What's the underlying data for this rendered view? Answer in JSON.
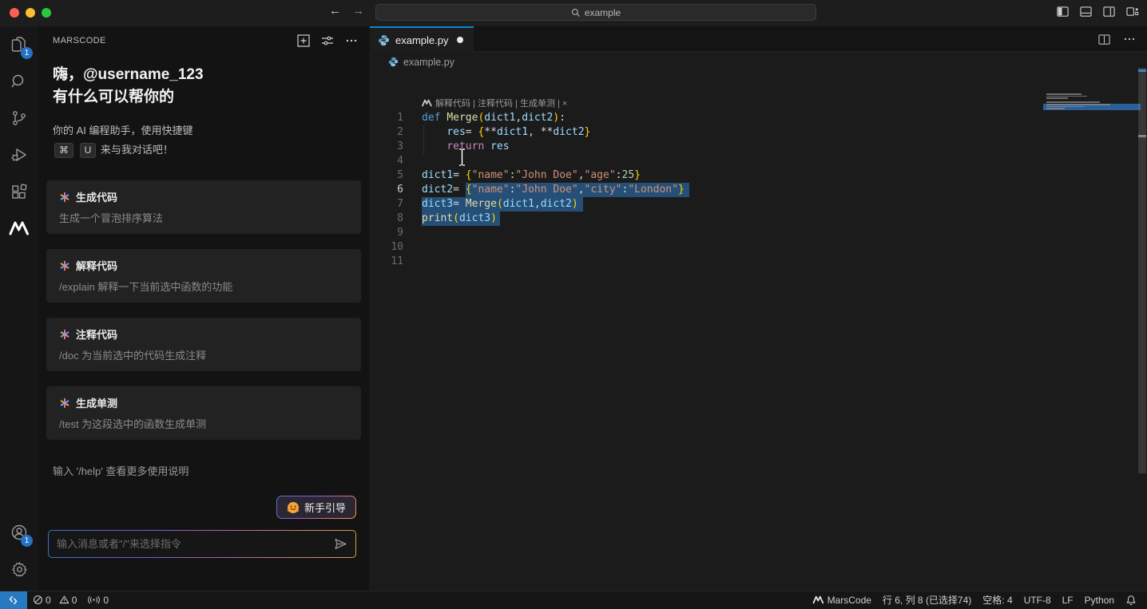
{
  "window": {
    "traffic_lights": [
      "close",
      "minimize",
      "zoom"
    ],
    "nav_back": "←",
    "nav_forward": "→",
    "search_value": "example",
    "layout_icon_names": [
      "toggle-sidebar-icon",
      "toggle-panel-icon",
      "toggle-secondary-sidebar-icon",
      "customize-layout-icon"
    ]
  },
  "activity_bar": {
    "explorer_badge": "1",
    "accounts_badge": "1",
    "icon_names": [
      "files-icon",
      "search-icon",
      "source-control-icon",
      "run-debug-icon",
      "extensions-icon",
      "marscode-icon",
      "accounts-icon",
      "settings-gear-icon"
    ]
  },
  "sidebar": {
    "title": "MARSCODE",
    "header_icon_names": [
      "new-chat-icon",
      "tune-icon",
      "more-actions-icon"
    ],
    "greeting_line1": "嗨，@username_123",
    "greeting_line2": "有什么可以帮你的",
    "subtitle_prefix": "你的 AI 编程助手，使用快捷键",
    "kbd_cmd": "⌘",
    "kbd_u": "U",
    "subtitle_suffix": "来与我对话吧！",
    "cards": [
      {
        "title": "生成代码",
        "desc": "生成一个冒泡排序算法"
      },
      {
        "title": "解释代码",
        "desc": "/explain 解释一下当前选中函数的功能"
      },
      {
        "title": "注释代码",
        "desc": "/doc 为当前选中的代码生成注释"
      },
      {
        "title": "生成单测",
        "desc": "/test 为这段选中的函数生成单测"
      }
    ],
    "help_text": "输入 '/help' 查看更多使用说明",
    "guide_button_label": "新手引导",
    "input_placeholder": "输入消息或者\"/\"来选择指令"
  },
  "editor": {
    "tab": {
      "filename": "example.py",
      "modified": true
    },
    "breadcrumb": "example.py",
    "codelens": {
      "items": [
        "解释代码",
        "注释代码",
        "生成单测",
        "×"
      ],
      "separator": " | "
    },
    "active_line": 6,
    "selection_summary": "lines 6-8, 74 chars",
    "code_lines": [
      {
        "n": 1,
        "tokens": [
          [
            "kw",
            "def"
          ],
          [
            "pl",
            " "
          ],
          [
            "fn",
            "Merge"
          ],
          [
            "b1",
            "("
          ],
          [
            "var",
            "dict1"
          ],
          [
            "pl",
            ","
          ],
          [
            "var",
            "dict2"
          ],
          [
            "b1",
            ")"
          ],
          [
            "pl",
            ":"
          ]
        ]
      },
      {
        "n": 2,
        "guide": true,
        "tokens": [
          [
            "pl",
            "    "
          ],
          [
            "var",
            "res"
          ],
          [
            "pl",
            "= "
          ],
          [
            "b1",
            "{"
          ],
          [
            "pl",
            "**"
          ],
          [
            "var",
            "dict1"
          ],
          [
            "pl",
            ", **"
          ],
          [
            "var",
            "dict2"
          ],
          [
            "b1",
            "}"
          ]
        ]
      },
      {
        "n": 3,
        "guide": true,
        "tokens": [
          [
            "pl",
            "    "
          ],
          [
            "ctrl",
            "return"
          ],
          [
            "pl",
            " "
          ],
          [
            "var",
            "res"
          ]
        ]
      },
      {
        "n": 4,
        "tokens": []
      },
      {
        "n": 5,
        "tokens": [
          [
            "var",
            "dict1"
          ],
          [
            "pl",
            "= "
          ],
          [
            "b1",
            "{"
          ],
          [
            "str",
            "\"name\""
          ],
          [
            "pl",
            ":"
          ],
          [
            "str",
            "\"John Doe\""
          ],
          [
            "pl",
            ","
          ],
          [
            "str",
            "\"age\""
          ],
          [
            "pl",
            ":"
          ],
          [
            "num",
            "25"
          ],
          [
            "b1",
            "}"
          ]
        ]
      },
      {
        "n": 6,
        "sel": [
          7,
          -1
        ],
        "tokens": [
          [
            "var",
            "dict2"
          ],
          [
            "pl",
            "= "
          ],
          [
            "b1",
            "{"
          ],
          [
            "str",
            "\"name\""
          ],
          [
            "pl",
            ":"
          ],
          [
            "str",
            "\"John Doe\""
          ],
          [
            "pl",
            ","
          ],
          [
            "str",
            "\"city\""
          ],
          [
            "pl",
            ":"
          ],
          [
            "str",
            "\"London\""
          ],
          [
            "b1",
            "}"
          ]
        ]
      },
      {
        "n": 7,
        "sel": [
          0,
          -1
        ],
        "tokens": [
          [
            "var",
            "dict3"
          ],
          [
            "pl",
            "= "
          ],
          [
            "fn",
            "Merge"
          ],
          [
            "b1",
            "("
          ],
          [
            "var",
            "dict1"
          ],
          [
            "pl",
            ","
          ],
          [
            "var",
            "dict2"
          ],
          [
            "b1",
            ")"
          ]
        ]
      },
      {
        "n": 8,
        "sel": [
          0,
          12.5
        ],
        "tokens": [
          [
            "fn",
            "print"
          ],
          [
            "b1",
            "("
          ],
          [
            "var",
            "dict3"
          ],
          [
            "b1",
            ")"
          ]
        ]
      },
      {
        "n": 9,
        "tokens": []
      },
      {
        "n": 10,
        "tokens": []
      },
      {
        "n": 11,
        "tokens": []
      }
    ],
    "minimap_selection": {
      "from_line": 6,
      "to_line": 8
    }
  },
  "status_bar": {
    "errors": "0",
    "warnings": "0",
    "ports": "0",
    "marscode_label": "MarsCode",
    "cursor_position": "行 6, 列 8 (已选择74)",
    "indentation": "空格: 4",
    "encoding": "UTF-8",
    "eol": "LF",
    "language": "Python"
  },
  "colors": {
    "accent_tab_border": "#0a84d0",
    "selection": "#264f78",
    "badge": "#2472c8",
    "remote_background": "#2779c2",
    "traffic": [
      "#ff5f57",
      "#febc2e",
      "#28c840"
    ]
  }
}
